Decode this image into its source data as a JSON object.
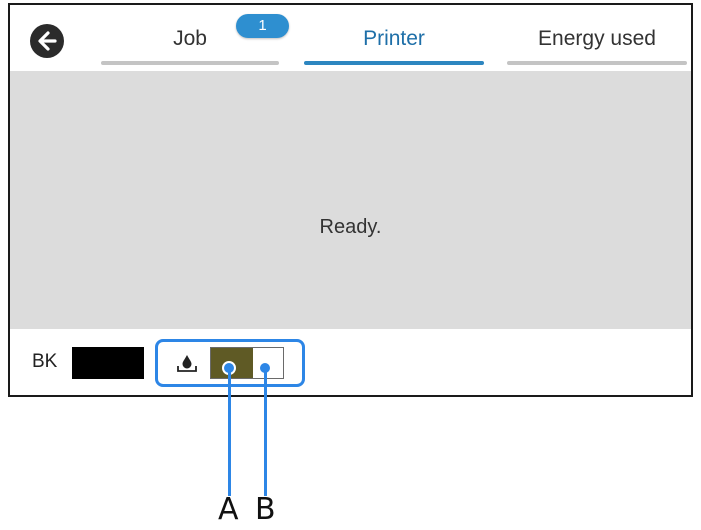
{
  "tabs": {
    "job": {
      "label": "Job",
      "badge": "1"
    },
    "printer": {
      "label": "Printer",
      "active": true
    },
    "energy": {
      "label": "Energy used"
    }
  },
  "status": {
    "message": "Ready."
  },
  "ink": {
    "label": "BK",
    "color": "#000000"
  },
  "maintenance_box": {
    "fill_fraction": 0.58,
    "fill_color": "#5f5a25"
  },
  "callouts": {
    "a": "A",
    "b": "B"
  },
  "colors": {
    "accent": "#2d86c0",
    "badge": "#2e8fd0",
    "callout": "#2d86e6",
    "status_bg": "#dcdcdc"
  },
  "icons": {
    "back": "back-arrow-icon",
    "maintenance": "ink-drop-tray-icon"
  }
}
